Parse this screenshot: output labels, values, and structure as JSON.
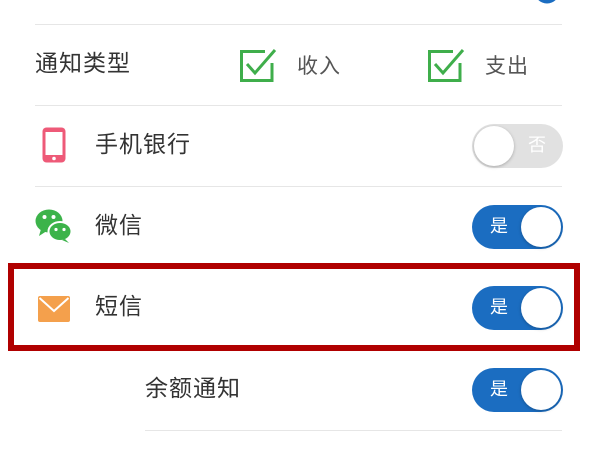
{
  "partial_top": {
    "icon": "circle-icon"
  },
  "notify_type": {
    "label": "通知类型",
    "options": [
      {
        "label": "收入",
        "checked": true,
        "icon": "checkbox-checked-icon"
      },
      {
        "label": "支出",
        "checked": true,
        "icon": "checkbox-checked-icon"
      }
    ]
  },
  "channels": [
    {
      "label": "手机银行",
      "icon": "phone-icon",
      "enabled": false,
      "toggle_text": "否"
    },
    {
      "label": "微信",
      "icon": "wechat-icon",
      "enabled": true,
      "toggle_text": "是"
    },
    {
      "label": "短信",
      "icon": "envelope-icon",
      "enabled": true,
      "toggle_text": "是",
      "highlighted": true
    }
  ],
  "balance_notice": {
    "label": "余额通知",
    "enabled": true,
    "toggle_text": "是"
  },
  "colors": {
    "accent": "#1b6dc1",
    "toggle_off": "#e1e1e1",
    "check_green": "#3fae4b",
    "highlight_red": "#b00000",
    "phone_pink": "#ee5a78",
    "wechat_green": "#3cb34a",
    "mail_orange": "#f4a04c",
    "text": "#333333",
    "divider": "#e6e6e6"
  }
}
